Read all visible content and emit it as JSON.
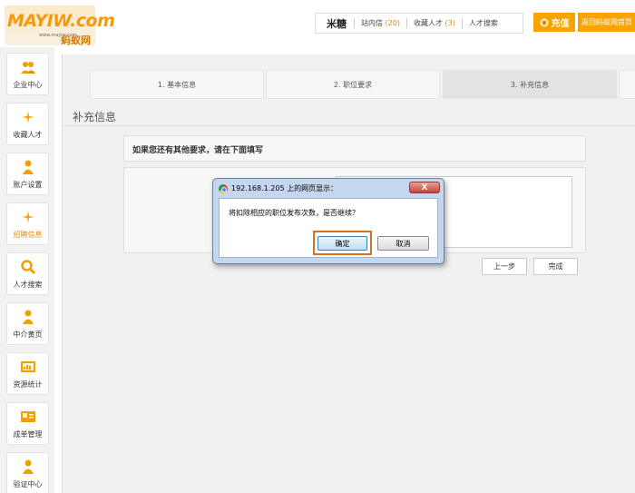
{
  "header": {
    "logo": {
      "brand": "MAYIW.com",
      "url_small": "www.mayiw.com",
      "cn": "蚂蚁网"
    },
    "user": {
      "name": "米糖"
    },
    "links": [
      {
        "label": "站内信",
        "count": "(20)"
      },
      {
        "label": "收藏人才",
        "count": "(3)"
      },
      {
        "label": "人才搜索",
        "count": ""
      }
    ],
    "recharge": "充值",
    "home": "返回蚂蚁网首页"
  },
  "sidebar": {
    "items": [
      {
        "label": "企业中心",
        "icon": "people-icon",
        "active": false
      },
      {
        "label": "收藏人才",
        "icon": "sparkle-icon",
        "active": false
      },
      {
        "label": "账户设置",
        "icon": "person-icon",
        "active": false
      },
      {
        "label": "招聘信息",
        "icon": "sparkle-icon",
        "active": true
      },
      {
        "label": "人才搜索",
        "icon": "search-icon",
        "active": false
      },
      {
        "label": "中介黄页",
        "icon": "person-icon",
        "active": false
      },
      {
        "label": "资源统计",
        "icon": "chart-card-icon",
        "active": false
      },
      {
        "label": "成单管理",
        "icon": "card-icon",
        "active": false
      },
      {
        "label": "验证中心",
        "icon": "person-icon",
        "active": false
      }
    ]
  },
  "steps": [
    {
      "label": "1.   基本信息"
    },
    {
      "label": "2.   职位要求"
    },
    {
      "label": "3.   补充信息"
    }
  ],
  "section_title": "补充信息",
  "form": {
    "hint": "如果您还有其他要求，请在下面填写",
    "textarea_value": "",
    "prev_button": "上一步",
    "finish_button": "完成"
  },
  "dialog": {
    "title": "192.168.1.205 上的网页显示：",
    "close_label": "X",
    "message": "将扣除相应的职位发布次数，是否继续？",
    "ok_label": "确定",
    "cancel_label": "取消"
  },
  "colors": {
    "accent": "#f7a300",
    "highlight": "#d7701f"
  }
}
